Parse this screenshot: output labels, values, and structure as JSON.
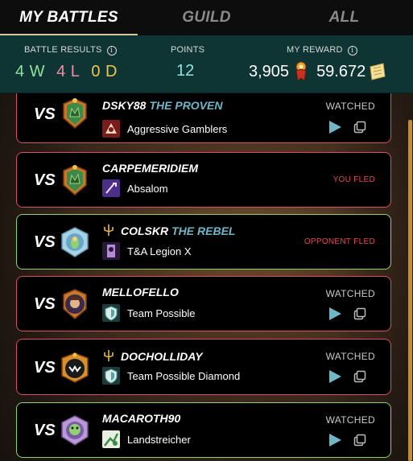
{
  "tabs": [
    {
      "label": "MY BATTLES",
      "active": true
    },
    {
      "label": "GUILD",
      "active": false
    },
    {
      "label": "ALL",
      "active": false
    }
  ],
  "summary": {
    "battle_results_label": "BATTLE RESULTS",
    "wins": "4 W",
    "losses": "4 L",
    "draws": "0 D",
    "points_label": "POINTS",
    "points_value": "12",
    "reward_label": "MY REWARD",
    "reward_dec": "3,905",
    "reward_sps": "59.672"
  },
  "vs_label": "VS",
  "battles": [
    {
      "player": "DSKY88",
      "title": "THE PROVEN",
      "guild": "Aggressive Gamblers",
      "status": "WATCHED",
      "result": "loss",
      "actions": true
    },
    {
      "player": "CARPEMERIDIEM",
      "title": "",
      "guild": "Absalom",
      "status": "YOU FLED",
      "result": "loss",
      "actions": false
    },
    {
      "player": "COLSKR",
      "title": "THE REBEL",
      "guild": "T&A Legion X",
      "status": "OPPONENT FLED",
      "result": "win",
      "actions": false
    },
    {
      "player": "MELLOFELLO",
      "title": "",
      "guild": "Team Possible",
      "status": "WATCHED",
      "result": "loss",
      "actions": true
    },
    {
      "player": "DOCHOLLIDAY",
      "title": "",
      "guild": "Team Possible Diamond",
      "status": "WATCHED",
      "result": "loss",
      "actions": true
    },
    {
      "player": "MACAROTH90",
      "title": "",
      "guild": "Landstreicher",
      "status": "WATCHED",
      "result": "win",
      "actions": true
    }
  ],
  "colors": {
    "win_border": "#8fd26f",
    "loss_border": "#d7505d",
    "summary_bg": "#0f3434",
    "title_blue": "#6fb7c8",
    "fled_red": "#e4494f"
  },
  "icons": {
    "dec": "dec-token-icon",
    "sps": "sps-token-icon",
    "play": "play-icon",
    "copy": "copy-icon",
    "info": "info-icon"
  }
}
